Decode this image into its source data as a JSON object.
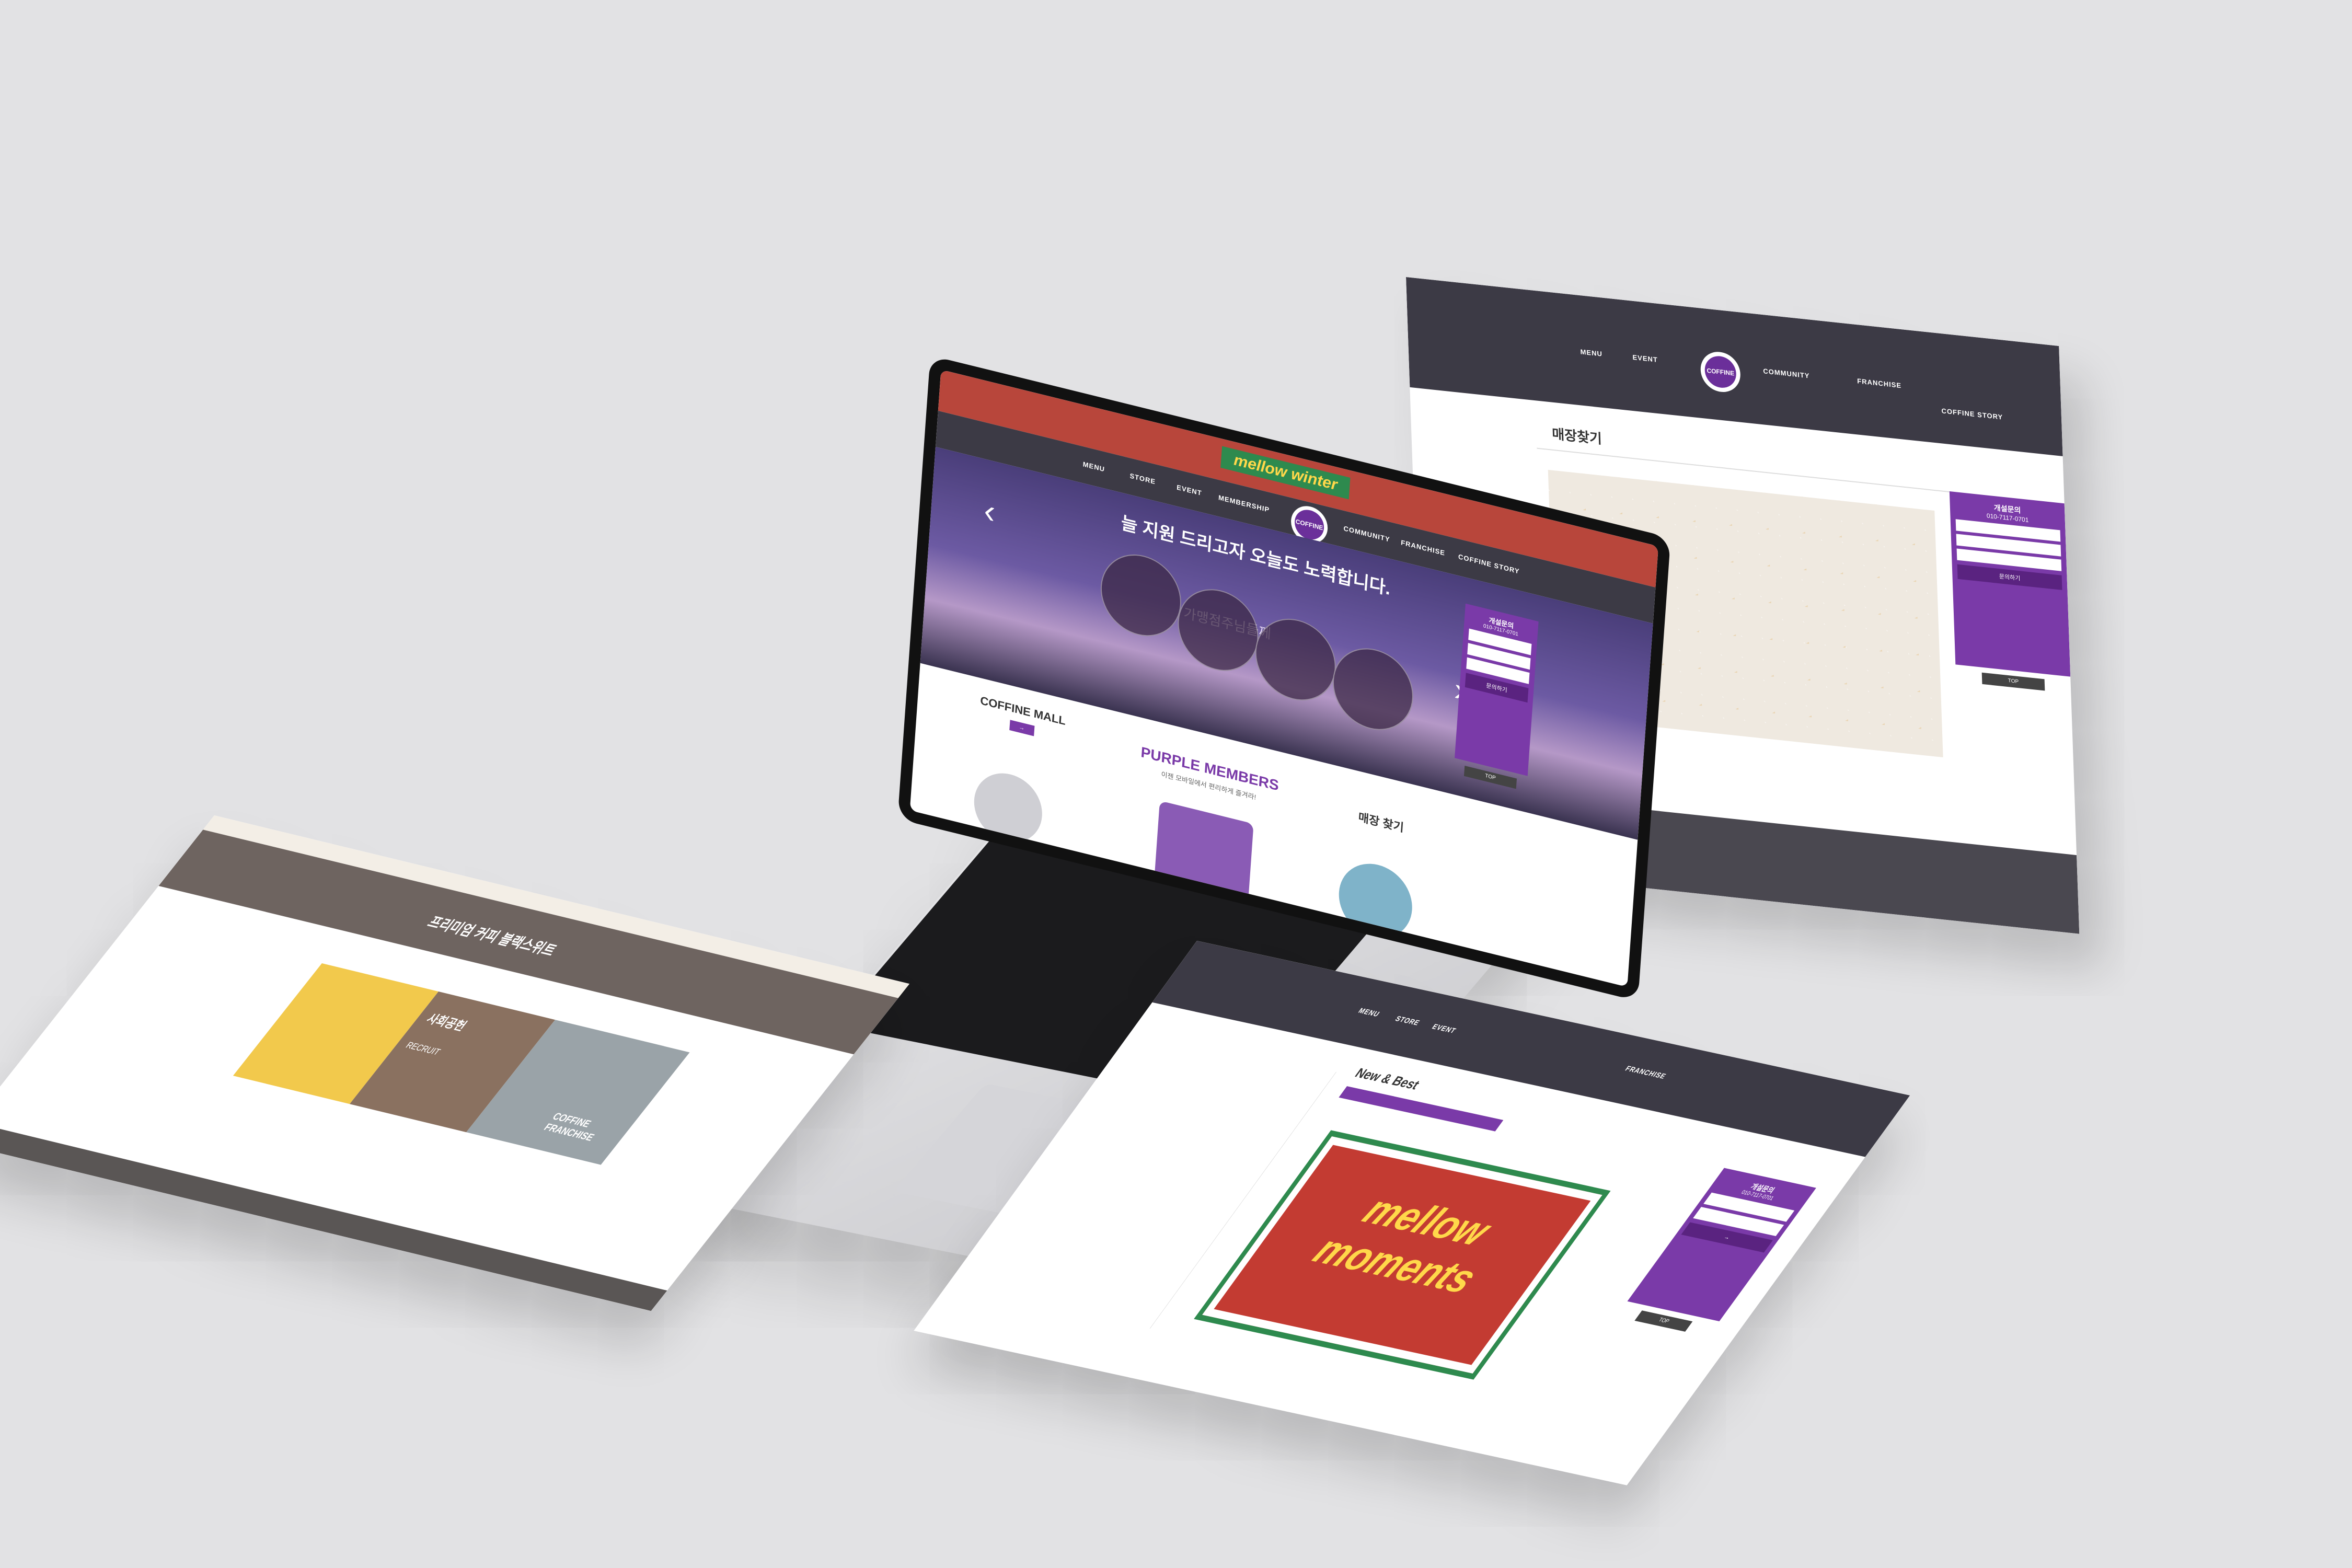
{
  "site": {
    "logo_text": "COFFINE",
    "nav": [
      "MENU",
      "STORE",
      "EVENT",
      "MEMBERSHIP",
      "COMMUNITY",
      "FRANCHISE",
      "COFFINE STORY"
    ],
    "banner_text": "mellow winter"
  },
  "laptop": {
    "hero_line1": "가맹점주님들께",
    "hero_line2": "늘 지원 드리고자 오늘도 노력합니다.",
    "widget_title": "개설문의",
    "widget_phone": "010-7117-0701",
    "widget_button": "문의하기",
    "top_label": "TOP",
    "mall_title": "COFFINE MALL",
    "members_title": "PURPLE MEMBERS",
    "members_sub": "이젠 모바일에서 편리하게 즐겨라!",
    "store_title": "매장 찾기"
  },
  "right_page": {
    "title": "매장찾기",
    "widget_title": "개설문의",
    "widget_phone": "010-7117-0701",
    "widget_button": "문의하기",
    "top_label": "TOP"
  },
  "left_page": {
    "banner_title": "프리미엄 커피 블랙스위트",
    "recruit_label": "RECRUIT",
    "recruit_title": "사회공헌",
    "franchise_label": "COFFINE FRANCHISE"
  },
  "bottom_page": {
    "section_title": "New & Best",
    "promo_line1": "mellow",
    "promo_line2": "moments",
    "widget_title": "개설문의",
    "widget_phone": "010-7117-0701",
    "top_label": "TOP"
  },
  "colors": {
    "brand_purple": "#7a3aa8",
    "banner_red": "#b8463b",
    "nav_dark": "#3c3a45"
  }
}
